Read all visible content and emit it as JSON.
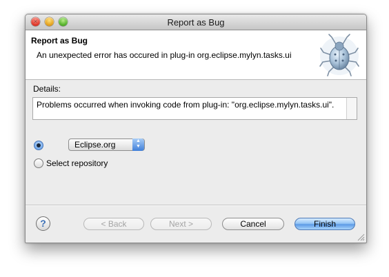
{
  "window": {
    "title": "Report as Bug"
  },
  "header": {
    "title": "Report as Bug",
    "message": "An unexpected error has occured in plug-in org.eclipse.mylyn.tasks.ui",
    "icon": "bug-icon"
  },
  "details": {
    "label": "Details:",
    "text": "Problems occurred when invoking code from plug-in: \"org.eclipse.mylyn.tasks.ui\"."
  },
  "repository": {
    "selected_option": "Eclipse.org",
    "option_checked": true,
    "select_repository_label": "Select repository",
    "select_repository_checked": false
  },
  "buttons": {
    "back": "< Back",
    "next": "Next >",
    "cancel": "Cancel",
    "finish": "Finish"
  },
  "colors": {
    "accent": "#5d9be6",
    "background": "#ececec"
  }
}
